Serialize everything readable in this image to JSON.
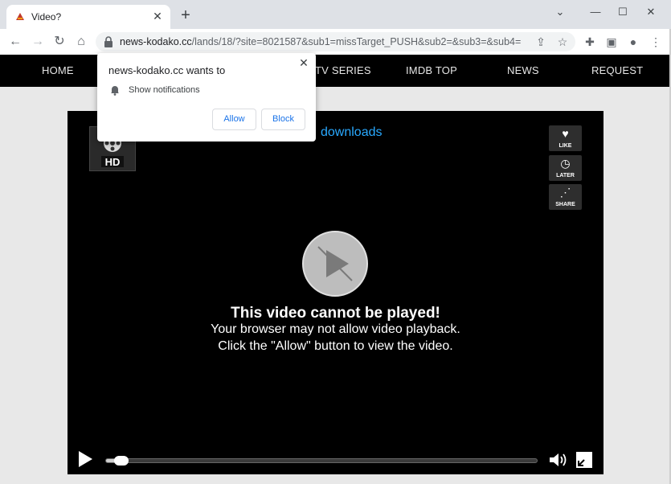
{
  "browser": {
    "tab_title": "Video?",
    "tab_close_icon": "close-icon",
    "new_tab_icon": "plus-icon",
    "url_host": "news-kodako.cc",
    "url_path": "/lands/18/?site=8021587&sub1=missTarget_PUSH&sub2=&sub3=&sub4=",
    "window_controls": [
      "minimize-icon",
      "maximize-icon",
      "close-icon"
    ]
  },
  "site_nav": {
    "items": [
      "HOME",
      "TV SERIES",
      "IMDB TOP",
      "NEWS",
      "REQUEST"
    ]
  },
  "player": {
    "downloads_link": "downloads",
    "side_buttons": [
      {
        "label": "LIKE",
        "icon": "heart-icon"
      },
      {
        "label": "LATER",
        "icon": "clock-icon"
      },
      {
        "label": "SHARE",
        "icon": "share-icon"
      }
    ],
    "headline": "This video cannot be played!",
    "line1": "Your browser may not allow video playback.",
    "line2": "Click the \"Allow\" button to view the video.",
    "logo_text": "HD"
  },
  "notification_popup": {
    "title": "news-kodako.cc wants to",
    "permission": "Show notifications",
    "allow_label": "Allow",
    "block_label": "Block"
  },
  "colors": {
    "link": "#29a9ff",
    "button_text": "#1a73e8"
  }
}
